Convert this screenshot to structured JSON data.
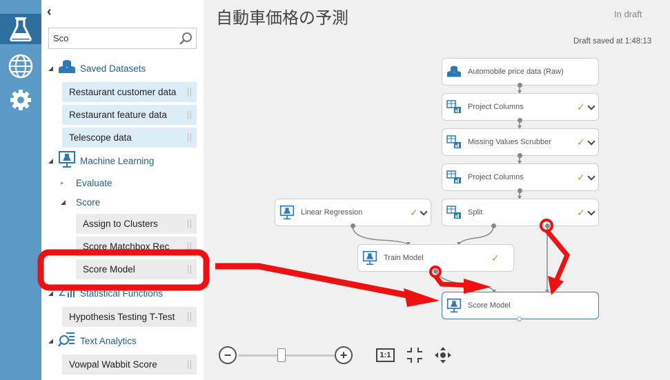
{
  "palette": {
    "search_value": "Sco",
    "categories": {
      "saved_datasets": "Saved Datasets",
      "machine_learning": "Machine Learning",
      "statistical_functions": "Statistical Functions",
      "text_analytics": "Text Analytics"
    },
    "subcategories": {
      "evaluate": "Evaluate",
      "score": "Score"
    },
    "datasets": [
      "Restaurant customer data",
      "Restaurant feature data",
      "Telescope data"
    ],
    "score_modules": [
      "Assign to Clusters",
      "Score Matchbox Rec",
      "Score Model"
    ],
    "stat_modules": [
      "Hypothesis Testing T-Test"
    ],
    "text_modules": [
      "Vowpal Wabbit Score"
    ]
  },
  "canvas": {
    "title": "自動車価格の予測",
    "status": "In draft",
    "saved_text": "Draft saved at 1:48:13",
    "nodes": {
      "dataset": "Automobile price data (Raw)",
      "project1": "Project Columns",
      "missing": "Missing Values Scrubber",
      "project2": "Project Columns",
      "split": "Split",
      "linear": "Linear Regression",
      "train": "Train Model",
      "score": "Score Model"
    },
    "zoom": {
      "reset_label": "1:1",
      "zoom_level": 0.45
    }
  },
  "colors": {
    "rail": "#5b9ac7",
    "rail_active": "#2f6f9f",
    "dataset_item_bg": "#dcedf8",
    "module_item_bg": "#ebebeb",
    "annotation_red": "#ee1111",
    "check_green": "#7cb342",
    "selected_border": "#3d7fb4"
  }
}
